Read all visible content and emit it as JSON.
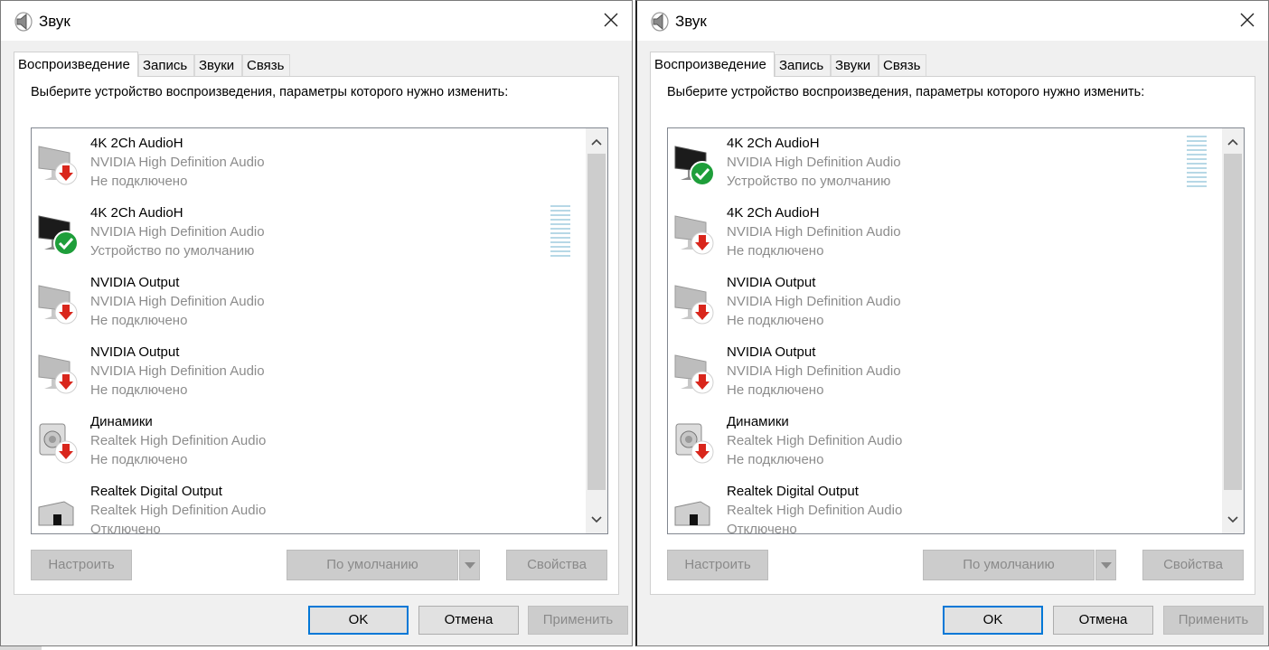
{
  "dialogs": [
    {
      "title": "Звук",
      "tabs": [
        "Воспроизведение",
        "Запись",
        "Звуки",
        "Связь"
      ],
      "prompt": "Выберите устройство воспроизведения, параметры которого нужно изменить:",
      "devices": [
        {
          "name": "4K 2Ch AudioH",
          "driver": "NVIDIA High Definition Audio",
          "status": "Не подключено",
          "icon": "monitor-icon",
          "state": "disconnected"
        },
        {
          "name": "4K 2Ch AudioH",
          "driver": "NVIDIA High Definition Audio",
          "status": "Устройство по умолчанию",
          "icon": "monitor-icon",
          "state": "default"
        },
        {
          "name": "NVIDIA Output",
          "driver": "NVIDIA High Definition Audio",
          "status": "Не подключено",
          "icon": "monitor-icon",
          "state": "disconnected"
        },
        {
          "name": "NVIDIA Output",
          "driver": "NVIDIA High Definition Audio",
          "status": "Не подключено",
          "icon": "monitor-icon",
          "state": "disconnected"
        },
        {
          "name": "Динамики",
          "driver": "Realtek High Definition Audio",
          "status": "Не подключено",
          "icon": "speaker-icon",
          "state": "disconnected"
        },
        {
          "name": "Realtek Digital Output",
          "driver": "Realtek High Definition Audio",
          "status": "Отключено",
          "icon": "digital-output-icon",
          "state": "disabled"
        }
      ],
      "buttons": {
        "configure": "Настроить",
        "set_default": "По умолчанию",
        "properties": "Свойства"
      },
      "footer": {
        "ok": "OK",
        "cancel": "Отмена",
        "apply": "Применить"
      }
    },
    {
      "title": "Звук",
      "tabs": [
        "Воспроизведение",
        "Запись",
        "Звуки",
        "Связь"
      ],
      "prompt": "Выберите устройство воспроизведения, параметры которого нужно изменить:",
      "devices": [
        {
          "name": "4K 2Ch AudioH",
          "driver": "NVIDIA High Definition Audio",
          "status": "Устройство по умолчанию",
          "icon": "monitor-icon",
          "state": "default"
        },
        {
          "name": "4K 2Ch AudioH",
          "driver": "NVIDIA High Definition Audio",
          "status": "Не подключено",
          "icon": "monitor-icon",
          "state": "disconnected"
        },
        {
          "name": "NVIDIA Output",
          "driver": "NVIDIA High Definition Audio",
          "status": "Не подключено",
          "icon": "monitor-icon",
          "state": "disconnected"
        },
        {
          "name": "NVIDIA Output",
          "driver": "NVIDIA High Definition Audio",
          "status": "Не подключено",
          "icon": "monitor-icon",
          "state": "disconnected"
        },
        {
          "name": "Динамики",
          "driver": "Realtek High Definition Audio",
          "status": "Не подключено",
          "icon": "speaker-icon",
          "state": "disconnected"
        },
        {
          "name": "Realtek Digital Output",
          "driver": "Realtek High Definition Audio",
          "status": "Отключено",
          "icon": "digital-output-icon",
          "state": "disabled"
        }
      ],
      "buttons": {
        "configure": "Настроить",
        "set_default": "По умолчанию",
        "properties": "Свойства"
      },
      "footer": {
        "ok": "OK",
        "cancel": "Отмена",
        "apply": "Применить"
      }
    }
  ],
  "colors": {
    "accent": "#0078d7",
    "default_badge": "#1e9e3a",
    "disconnected_badge": "#d9261c",
    "meter": "#b7d8e6"
  }
}
